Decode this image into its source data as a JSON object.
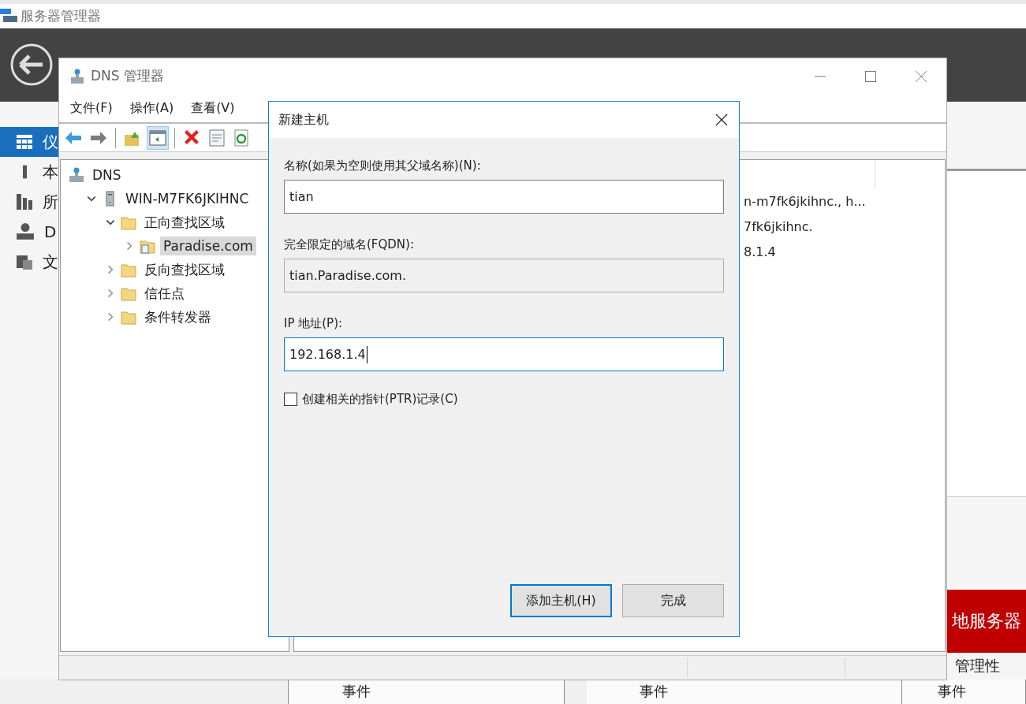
{
  "server_manager": {
    "title": "服务器管理器",
    "sidebar": [
      {
        "label": "仪",
        "kind": "dashboard",
        "selected": true
      },
      {
        "label": "本",
        "kind": "server",
        "selected": false
      },
      {
        "label": "所",
        "kind": "servers",
        "selected": false
      },
      {
        "label": "D",
        "kind": "dns",
        "selected": false
      },
      {
        "label": "文",
        "kind": "files",
        "selected": false
      }
    ],
    "banner": "地服务器",
    "banner_caption": "管理性",
    "tiles": [
      "事件",
      "事件",
      "事件"
    ]
  },
  "dns_window": {
    "title": "DNS 管理器",
    "menu": [
      "文件(F)",
      "操作(A)",
      "查看(V)"
    ],
    "toolbar": [
      {
        "kind": "back",
        "pressed": false
      },
      {
        "kind": "forward",
        "pressed": false
      },
      {
        "kind": "up",
        "pressed": false
      },
      {
        "kind": "pane",
        "pressed": true
      },
      {
        "kind": "delete",
        "pressed": false
      },
      {
        "kind": "properties",
        "pressed": false
      },
      {
        "kind": "refresh",
        "pressed": false
      }
    ],
    "tree": [
      {
        "label": "DNS",
        "kind": "root",
        "selected": false,
        "children": [
          {
            "label": "WIN-M7FK6JKIHNC",
            "kind": "server",
            "expanded": true,
            "selected": false,
            "children": [
              {
                "label": "正向查找区域",
                "kind": "folder",
                "expanded": true,
                "selected": false,
                "children": [
                  {
                    "label": "Paradise.com",
                    "kind": "zone",
                    "expanded": false,
                    "selected": true
                  }
                ]
              },
              {
                "label": "反向查找区域",
                "kind": "folder",
                "expanded": false,
                "selected": false
              },
              {
                "label": "信任点",
                "kind": "folder",
                "expanded": false,
                "selected": false
              },
              {
                "label": "条件转发器",
                "kind": "folder",
                "expanded": false,
                "selected": false
              }
            ]
          }
        ]
      }
    ],
    "list_rows": [
      "n-m7fk6jkihnc., h...",
      "7fk6jkihnc.",
      "8.1.4"
    ]
  },
  "dialog": {
    "title": "新建主机",
    "fields": [
      {
        "label": "名称(如果为空则使用其父域名称)(N):",
        "value": "tian",
        "disabled": false,
        "focused": false
      },
      {
        "label": "完全限定的域名(FQDN):",
        "value": "tian.Paradise.com.",
        "disabled": true,
        "focused": false
      },
      {
        "label": "IP 地址(P):",
        "value": "192.168.1.4",
        "disabled": false,
        "focused": true
      }
    ],
    "checkbox": {
      "label": "创建相关的指针(PTR)记录(C)",
      "checked": false
    },
    "buttons": [
      {
        "label": "添加主机(H)",
        "default": true
      },
      {
        "label": "完成",
        "default": false
      }
    ]
  }
}
